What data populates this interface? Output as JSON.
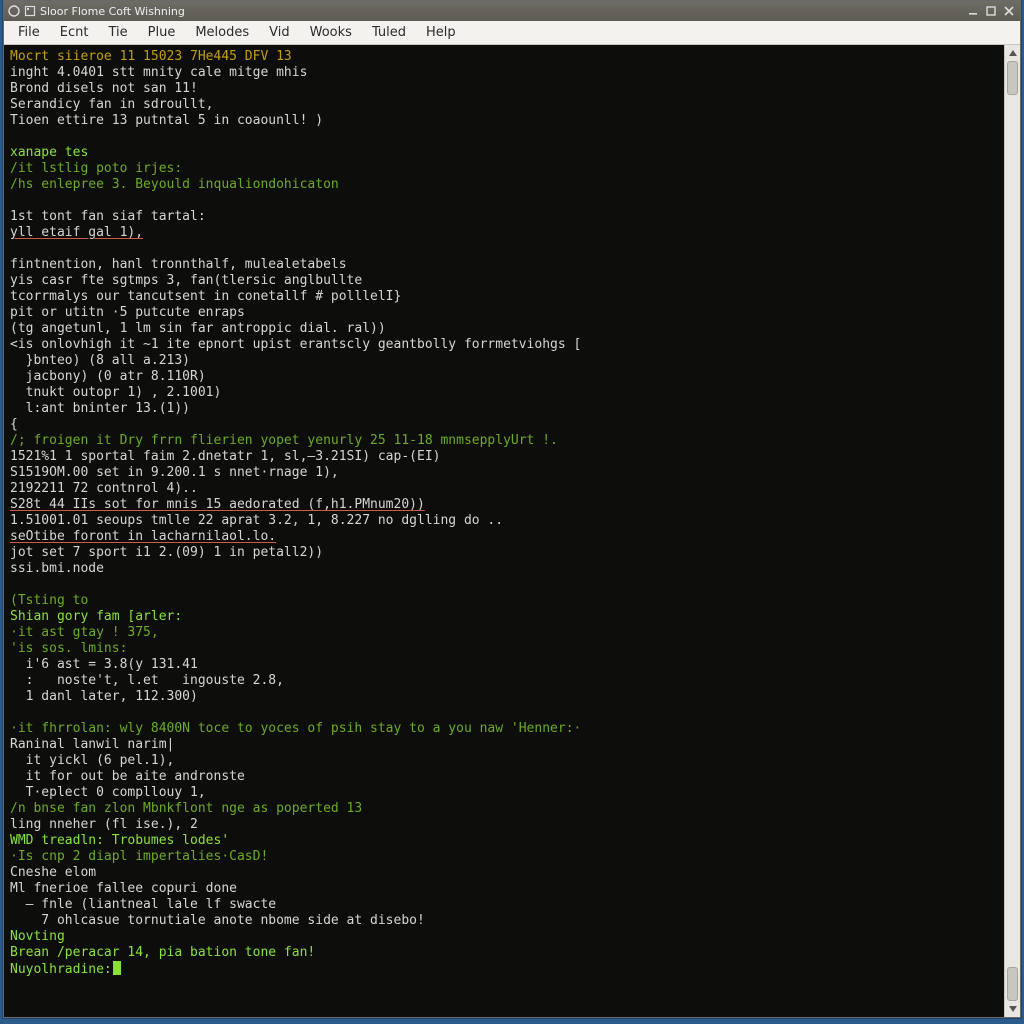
{
  "window": {
    "title": "Sloor Flome Coft Wishning"
  },
  "menubar": {
    "items": [
      {
        "label": "File"
      },
      {
        "label": "Ecnt"
      },
      {
        "label": "Tie"
      },
      {
        "label": "Plue"
      },
      {
        "label": "Melodes"
      },
      {
        "label": "Vid"
      },
      {
        "label": "Wooks"
      },
      {
        "label": "Tuled"
      },
      {
        "label": "Help"
      }
    ]
  },
  "terminal": {
    "lines": [
      {
        "cls": "c-y",
        "text": "Mocrt siieroe 11 15023 7He445 DFV 13"
      },
      {
        "cls": "c-w",
        "text": "inght 4.0401 stt mnity cale mitge mhis"
      },
      {
        "cls": "c-w",
        "text": "Brond disels not san 11!"
      },
      {
        "cls": "c-w",
        "text": "Serandicy fan in sdroullt,"
      },
      {
        "cls": "c-w",
        "text": "Tioen ettire 13 putntal 5 in coaounll! )"
      },
      {
        "cls": "",
        "text": ""
      },
      {
        "cls": "c-g",
        "text": "xanape tes"
      },
      {
        "cls": "c-dg",
        "text": "/it lstlig poto irjes:"
      },
      {
        "cls": "c-dg",
        "text": "/hs enlepree 3. Beyould inqualiondohicaton"
      },
      {
        "cls": "",
        "text": ""
      },
      {
        "cls": "c-w",
        "text": "1st tont fan siaf tartal:"
      },
      {
        "cls": "c-w u",
        "text": "yll etaif gal 1),"
      },
      {
        "cls": "",
        "text": ""
      },
      {
        "cls": "c-w",
        "text": "fintnention, hanl tronnthalf, mulealetabels"
      },
      {
        "cls": "c-w",
        "text": "yis casr fte sgtmps 3, fan(tlersic anglbullte"
      },
      {
        "cls": "c-w",
        "text": "tcorrmalys our tancutsent in conetallf # polllelI}"
      },
      {
        "cls": "c-w",
        "text": "pit or utitn ·5 putcute enraps"
      },
      {
        "cls": "c-w",
        "text": "(tg angetunl, 1 lm sin far antroppic dial. ral))"
      },
      {
        "cls": "c-w",
        "text": "<is onlovhigh it ~1 ite epnort upist erantscly geantbolly forrmetviohgs ["
      },
      {
        "cls": "c-w",
        "text": "  }bnteo) (8 all a.213)"
      },
      {
        "cls": "c-w",
        "text": "  jacbony) (0 atr 8.110R)"
      },
      {
        "cls": "c-w",
        "text": "  tnukt outopr 1) , 2.1001)"
      },
      {
        "cls": "c-w",
        "text": "  l:ant bninter 13.(1))"
      },
      {
        "cls": "c-w",
        "text": "{"
      },
      {
        "cls": "c-dg",
        "text": "/; froigen it Dry frrn flierien yopet yenurly 25 11-18 mnmsepplyUrt !."
      },
      {
        "cls": "c-w",
        "text": "1521%1 1 sportal faim 2.dnetatr 1, sl,—3.21SI) cap-(EI)"
      },
      {
        "cls": "c-w",
        "text": "S1519OM.00 set in 9.200.1 s nnet·rnage 1),"
      },
      {
        "cls": "c-w",
        "text": "2192211 72 contnrol 4).."
      },
      {
        "cls": "c-w u",
        "text": "S28t 44 IIs sot for mnis 15 aedorated (f,h1.PMnum20))"
      },
      {
        "cls": "c-w",
        "text": "1.51001.01 seoups tmlle 22 aprat 3.2, 1, 8.227 no dglling do .."
      },
      {
        "cls": "c-w u",
        "text": "seOtibe foront in lacharnilaol.lo."
      },
      {
        "cls": "c-w",
        "text": "jot set 7 sport i1 2.(09) 1 in petall2))"
      },
      {
        "cls": "c-w",
        "text": "ssi.bmi.node"
      },
      {
        "cls": "",
        "text": ""
      },
      {
        "cls": "c-dg",
        "text": "(Tsting to"
      },
      {
        "cls": "c-g",
        "text": "Shian gory fam [arler:"
      },
      {
        "cls": "c-dg",
        "text": "·it ast gtay ! 375,"
      },
      {
        "cls": "c-dg",
        "text": "'is sos. lmins:"
      },
      {
        "cls": "c-w",
        "text": "  i'6 ast = 3.8(y 131.41"
      },
      {
        "cls": "c-w",
        "text": "  :   noste't, l.et   ingouste 2.8,"
      },
      {
        "cls": "c-w",
        "text": "  1 danl later, 112.300)"
      },
      {
        "cls": "",
        "text": ""
      },
      {
        "cls": "c-dg",
        "text": "·it fhrrolan: wly 8400N toce to yoces of psih stay to a you naw 'Henner:·"
      },
      {
        "cls": "c-w",
        "text": "Raninal lanwil narim|"
      },
      {
        "cls": "c-w",
        "text": "  it yickl (6 pel.1),"
      },
      {
        "cls": "c-w",
        "text": "  it for out be aite andronste"
      },
      {
        "cls": "c-w",
        "text": "  T·eplect 0 compllouy 1,"
      },
      {
        "cls": "c-dg",
        "text": "/n bnse fan zlon Mbnkflont nge as poperted 13"
      },
      {
        "cls": "c-w",
        "text": "ling nneher (fl ise.), 2"
      },
      {
        "cls": "c-g",
        "text": "WMD treadln: Trobumes lodes'"
      },
      {
        "cls": "c-dg",
        "text": "·Is cnp 2 diapl impertalies·CasD!"
      },
      {
        "cls": "c-w",
        "text": "Cneshe elom"
      },
      {
        "cls": "c-w",
        "text": "Ml fnerioe fallee copuri done"
      },
      {
        "cls": "c-w",
        "text": "  — fnle (liantneal lale lf swacte"
      },
      {
        "cls": "c-w",
        "text": "    7 ohlcasue tornutiale anote nbome side at disebo!"
      },
      {
        "cls": "c-g",
        "text": "Novting"
      },
      {
        "cls": "c-g",
        "text": "Brean /peracar 14, pia bation tone fan!"
      }
    ],
    "prompt": "Nuyolhradine:"
  }
}
